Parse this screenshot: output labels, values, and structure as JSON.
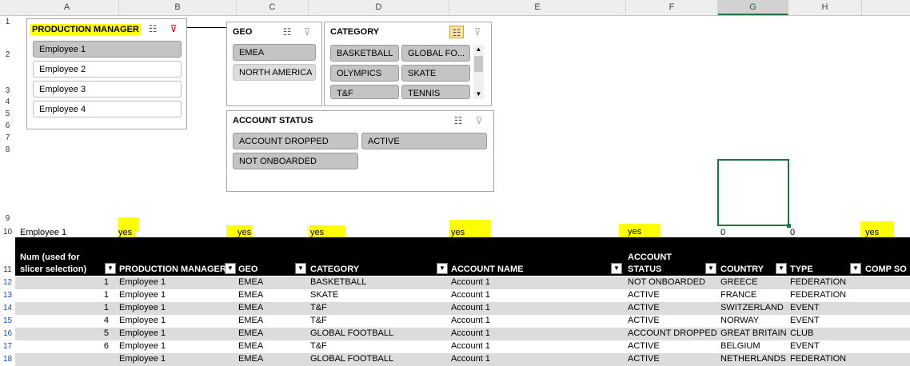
{
  "columns": [
    "A",
    "B",
    "C",
    "D",
    "E",
    "F",
    "G",
    "H"
  ],
  "rows": [
    "1",
    "2",
    "3",
    "4",
    "5",
    "6",
    "7",
    "8",
    "9",
    "10",
    "11",
    "12",
    "13",
    "14",
    "15",
    "16",
    "17",
    "18"
  ],
  "slicers": {
    "production_manager": {
      "title": "PRODUCTION MANAGER",
      "items": [
        "Employee 1",
        "Employee 2",
        "Employee 3",
        "Employee 4"
      ]
    },
    "geo": {
      "title": "GEO",
      "items": [
        "EMEA",
        "NORTH AMERICA"
      ]
    },
    "category": {
      "title": "CATEGORY",
      "items": [
        "BASKETBALL",
        "GLOBAL FO...",
        "OLYMPICS",
        "SKATE",
        "T&F",
        "TENNIS"
      ]
    },
    "account_status": {
      "title": "ACCOUNT STATUS",
      "items": [
        "ACCOUNT DROPPED",
        "ACTIVE",
        "NOT ONBOARDED"
      ]
    }
  },
  "row10": {
    "a": "Employee 1",
    "b": "yes",
    "c": "yes",
    "d": "yes",
    "e": "yes",
    "f": "yes",
    "g": "0",
    "g2": "0",
    "h": "yes"
  },
  "table_headers": {
    "num_line1": "Num (used for",
    "num_line2": "slicer selection)",
    "prod": "PRODUCTION MANAGER",
    "geo": "GEO",
    "category": "CATEGORY",
    "account_name": "ACCOUNT NAME",
    "status_line1": "ACCOUNT",
    "status_line2": "STATUS",
    "country": "COUNTRY",
    "type": "TYPE",
    "comp": "COMP SO"
  },
  "table_rows": [
    {
      "num": "1",
      "pm": "Employee 1",
      "geo": "EMEA",
      "cat": "BASKETBALL",
      "acc": "Account 1",
      "status": "NOT ONBOARDED",
      "country": "GREECE",
      "type": "FEDERATION"
    },
    {
      "num": "1",
      "pm": "Employee 1",
      "geo": "EMEA",
      "cat": "SKATE",
      "acc": "Account 1",
      "status": "ACTIVE",
      "country": "FRANCE",
      "type": "FEDERATION"
    },
    {
      "num": "1",
      "pm": "Employee 1",
      "geo": "EMEA",
      "cat": "T&F",
      "acc": "Account 1",
      "status": "ACTIVE",
      "country": "SWITZERLAND",
      "type": "EVENT"
    },
    {
      "num": "4",
      "pm": "Employee 1",
      "geo": "EMEA",
      "cat": "T&F",
      "acc": "Account 1",
      "status": "ACTIVE",
      "country": "NORWAY",
      "type": "EVENT"
    },
    {
      "num": "5",
      "pm": "Employee 1",
      "geo": "EMEA",
      "cat": "GLOBAL FOOTBALL",
      "acc": "Account 1",
      "status": "ACCOUNT DROPPED",
      "country": "GREAT BRITAIN",
      "type": "CLUB"
    },
    {
      "num": "6",
      "pm": "Employee 1",
      "geo": "EMEA",
      "cat": "T&F",
      "acc": "Account 1",
      "status": "ACTIVE",
      "country": "BELGIUM",
      "type": "EVENT"
    },
    {
      "num": "",
      "pm": "Employee 1",
      "geo": "EMEA",
      "cat": "GLOBAL FOOTBALL",
      "acc": "Account 1",
      "status": "ACTIVE",
      "country": "NETHERLANDS",
      "type": "FEDERATION"
    }
  ],
  "icons": {
    "multiselect": "multiselect-icon",
    "clear_filter": "clear-filter-icon",
    "dropdown": "dropdown-arrow-icon"
  }
}
